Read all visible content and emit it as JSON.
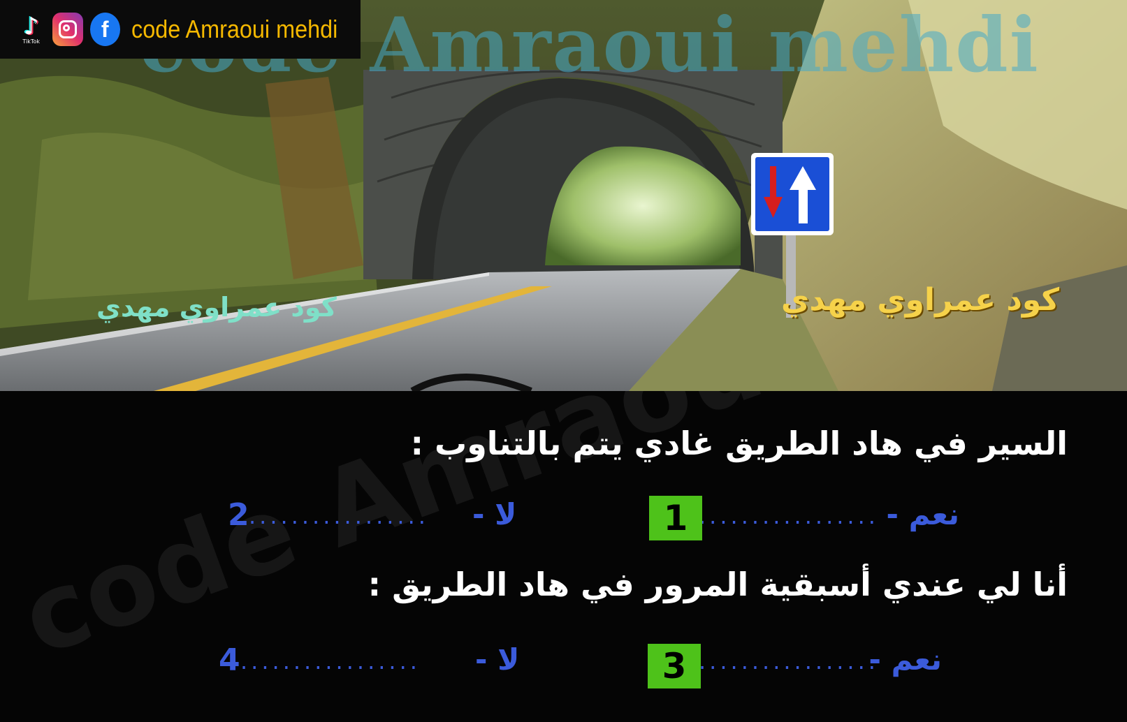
{
  "header": {
    "tiktok_label": "TikTok",
    "facebook_letter": "f",
    "brand": "code Amraoui mehdi"
  },
  "watermarks": {
    "top": "code Amraoui mehdi",
    "left_arabic": "كود عمراوي مهدي",
    "right_arabic": "كود عمراوي مهدي",
    "diagonal": "code Amraoui mehdi"
  },
  "questions": [
    {
      "text": "السير في هاد الطريق غادي يتم  بالتناوب :",
      "options": [
        {
          "label": "- نعم",
          "number": "1",
          "selected": true
        },
        {
          "label": "- لا",
          "number": "2",
          "selected": false
        }
      ]
    },
    {
      "text": "أنا لي عندي أسبقية المرور في هاد الطريق :",
      "options": [
        {
          "label": "- نعم",
          "number": "3",
          "selected": true
        },
        {
          "label": "- لا",
          "number": "4",
          "selected": false
        }
      ]
    }
  ],
  "dots": ".................",
  "colors": {
    "selected_bg": "#4ec21a",
    "answer_text": "#3b5bdb",
    "brand_text": "#f5b800",
    "sign_bg": "#1a4fd6"
  },
  "icons": [
    "tiktok-icon",
    "instagram-icon",
    "facebook-icon",
    "priority-over-oncoming-sign"
  ]
}
